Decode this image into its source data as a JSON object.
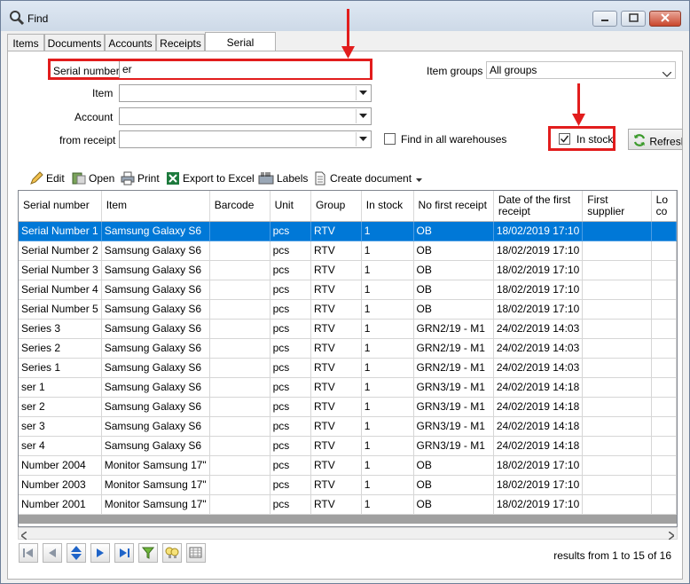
{
  "window": {
    "title": "Find"
  },
  "tabs": [
    "Items",
    "Documents",
    "Accounts",
    "Receipts",
    "Serial numbers"
  ],
  "active_tab_index": 4,
  "filters": {
    "serial_number_label": "Serial number",
    "serial_number_value": "er",
    "item_label": "Item",
    "item_value": "",
    "account_label": "Account",
    "account_value": "",
    "receipt_label": "from receipt",
    "receipt_value": "",
    "item_groups_label": "Item groups",
    "item_groups_value": "All groups",
    "find_all_warehouses_label": "Find in all warehouses",
    "find_all_warehouses_checked": false,
    "in_stock_label": "In stock",
    "in_stock_checked": true,
    "refresh_label": "Refresh"
  },
  "toolbar": {
    "edit": "Edit",
    "open": "Open",
    "print": "Print",
    "export": "Export to Excel",
    "labels": "Labels",
    "create_document": "Create document"
  },
  "table": {
    "columns": [
      "Serial number",
      "Item",
      "Barcode",
      "Unit",
      "Group",
      "In stock",
      "No first receipt",
      "Date of the first receipt",
      "First supplier",
      "Lo co"
    ],
    "rows": [
      [
        "Serial Number 1",
        "Samsung Galaxy S6",
        "",
        "pcs",
        "RTV",
        "1",
        "OB",
        "18/02/2019 17:10",
        "",
        ""
      ],
      [
        "Serial Number 2",
        "Samsung Galaxy S6",
        "",
        "pcs",
        "RTV",
        "1",
        "OB",
        "18/02/2019 17:10",
        "",
        ""
      ],
      [
        "Serial Number 3",
        "Samsung Galaxy S6",
        "",
        "pcs",
        "RTV",
        "1",
        "OB",
        "18/02/2019 17:10",
        "",
        ""
      ],
      [
        "Serial Number 4",
        "Samsung Galaxy S6",
        "",
        "pcs",
        "RTV",
        "1",
        "OB",
        "18/02/2019 17:10",
        "",
        ""
      ],
      [
        "Serial Number 5",
        "Samsung Galaxy S6",
        "",
        "pcs",
        "RTV",
        "1",
        "OB",
        "18/02/2019 17:10",
        "",
        ""
      ],
      [
        "Series 3",
        "Samsung Galaxy S6",
        "",
        "pcs",
        "RTV",
        "1",
        "GRN2/19 - M1",
        "24/02/2019 14:03",
        "",
        ""
      ],
      [
        "Series 2",
        "Samsung Galaxy S6",
        "",
        "pcs",
        "RTV",
        "1",
        "GRN2/19 - M1",
        "24/02/2019 14:03",
        "",
        ""
      ],
      [
        "Series 1",
        "Samsung Galaxy S6",
        "",
        "pcs",
        "RTV",
        "1",
        "GRN2/19 - M1",
        "24/02/2019 14:03",
        "",
        ""
      ],
      [
        "ser 1",
        "Samsung Galaxy S6",
        "",
        "pcs",
        "RTV",
        "1",
        "GRN3/19 - M1",
        "24/02/2019 14:18",
        "",
        ""
      ],
      [
        "ser 2",
        "Samsung Galaxy S6",
        "",
        "pcs",
        "RTV",
        "1",
        "GRN3/19 - M1",
        "24/02/2019 14:18",
        "",
        ""
      ],
      [
        "ser 3",
        "Samsung Galaxy S6",
        "",
        "pcs",
        "RTV",
        "1",
        "GRN3/19 - M1",
        "24/02/2019 14:18",
        "",
        ""
      ],
      [
        "ser 4",
        "Samsung Galaxy S6",
        "",
        "pcs",
        "RTV",
        "1",
        "GRN3/19 - M1",
        "24/02/2019 14:18",
        "",
        ""
      ],
      [
        "Number 2004",
        "Monitor Samsung 17\"",
        "",
        "pcs",
        "RTV",
        "1",
        "OB",
        "18/02/2019 17:10",
        "",
        ""
      ],
      [
        "Number 2003",
        "Monitor Samsung 17\"",
        "",
        "pcs",
        "RTV",
        "1",
        "OB",
        "18/02/2019 17:10",
        "",
        ""
      ],
      [
        "Number 2001",
        "Monitor Samsung 17\"",
        "",
        "pcs",
        "RTV",
        "1",
        "OB",
        "18/02/2019 17:10",
        "",
        ""
      ]
    ],
    "selected_row_index": 0
  },
  "status": {
    "results": "results from 1 to 15 of 16"
  },
  "colors": {
    "annotation": "#e21d1d",
    "selection": "#0078d7"
  }
}
